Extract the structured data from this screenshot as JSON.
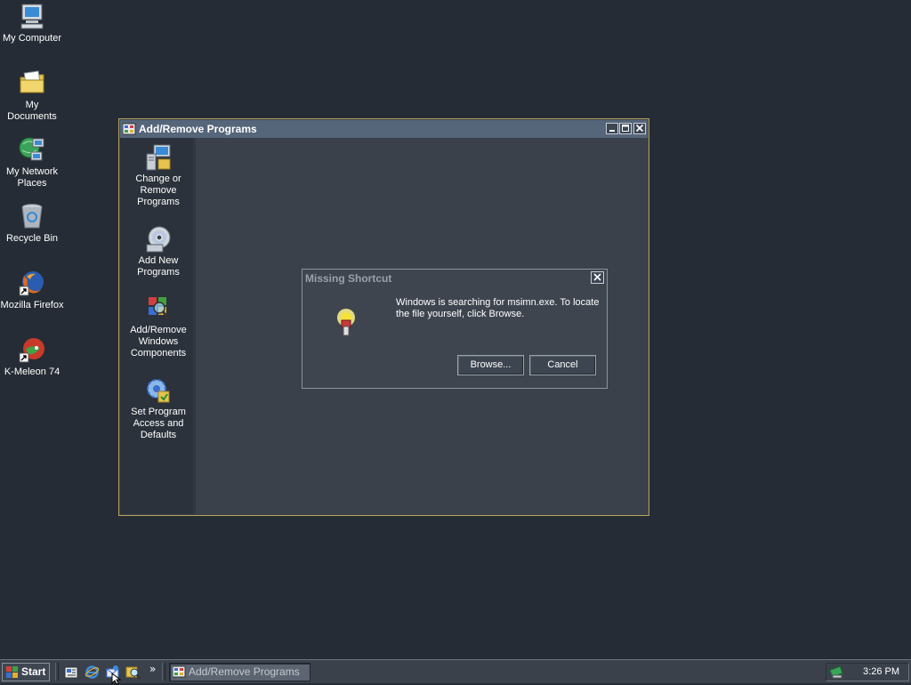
{
  "desktop": {
    "icons": [
      {
        "label": "My Computer",
        "icon": "computer-icon"
      },
      {
        "label": "My Documents",
        "icon": "folder-documents-icon"
      },
      {
        "label": "My Network Places",
        "icon": "network-icon"
      },
      {
        "label": "Recycle Bin",
        "icon": "recycle-bin-icon"
      },
      {
        "label": "Mozilla Firefox",
        "icon": "firefox-icon"
      },
      {
        "label": "K-Meleon 74",
        "icon": "kmeleon-icon"
      }
    ]
  },
  "window": {
    "title": "Add/Remove Programs",
    "controls": [
      "minimize",
      "maximize",
      "close"
    ],
    "sidebar": [
      {
        "label": "Change or Remove Programs",
        "icon": "change-remove-programs-icon"
      },
      {
        "label": "Add New Programs",
        "icon": "add-new-programs-icon"
      },
      {
        "label": "Add/Remove Windows Components",
        "icon": "windows-components-icon"
      },
      {
        "label": "Set Program Access and Defaults",
        "icon": "program-access-defaults-icon"
      }
    ]
  },
  "dialog": {
    "title": "Missing Shortcut",
    "message": "Windows is searching for msimn.exe. To locate the file yourself, click Browse.",
    "browse_label": "Browse...",
    "cancel_label": "Cancel",
    "icon": "flashlight-icon"
  },
  "taskbar": {
    "start_label": "Start",
    "quick_launch": [
      "show-desktop-icon",
      "internet-explorer-icon",
      "outlook-express-icon",
      "search-icon"
    ],
    "overflow": "»",
    "task_label": "Add/Remove Programs",
    "clock": "3:26 PM"
  },
  "colors": {
    "desktop_bg": "#252c35",
    "window_border": "#b6a25a",
    "titlebar": "#55657a",
    "sidebar_bg": "#2b323b"
  }
}
